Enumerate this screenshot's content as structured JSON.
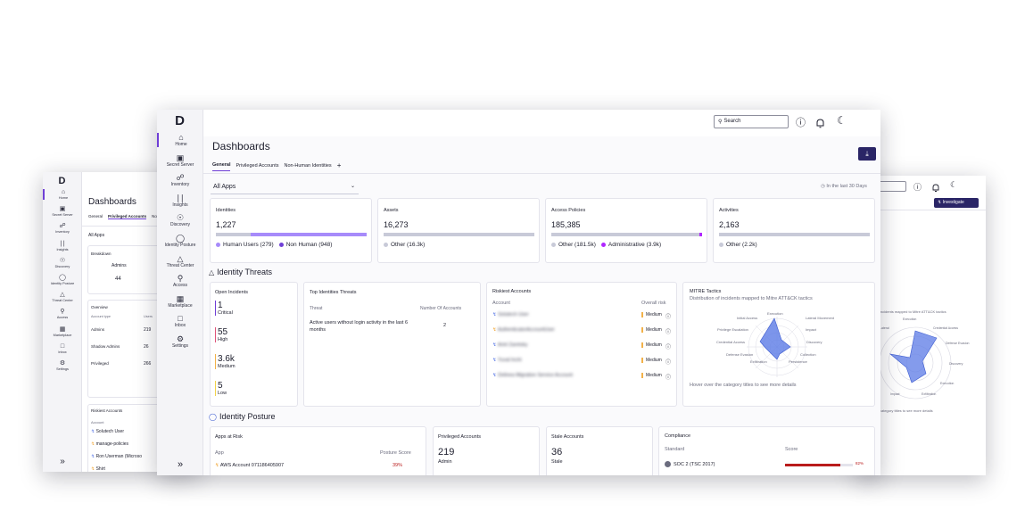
{
  "colors": {
    "accent": "#6f3fd6",
    "accent_light": "#a78bfa",
    "critical": "#b91c1c",
    "medium": "#f2b24a"
  },
  "nav": [
    {
      "label": "Home",
      "icon": "home-icon"
    },
    {
      "label": "Secret Server",
      "icon": "server-icon"
    },
    {
      "label": "Inventory",
      "icon": "inventory-icon"
    },
    {
      "label": "Insights",
      "icon": "chart-icon"
    },
    {
      "label": "Discovery",
      "icon": "compass-icon"
    },
    {
      "label": "Identity Posture",
      "icon": "shield-icon"
    },
    {
      "label": "Threat Center",
      "icon": "warning-icon"
    },
    {
      "label": "Access",
      "icon": "user-key-icon"
    },
    {
      "label": "Marketplace",
      "icon": "store-icon"
    },
    {
      "label": "Inbox",
      "icon": "inbox-icon"
    },
    {
      "label": "Settings",
      "icon": "gear-icon"
    }
  ],
  "back": {
    "title": "Dashboards",
    "tabs": [
      "General",
      "Privileged Accounts",
      "Non"
    ],
    "filter": "All Apps",
    "breakdown_label": "Breakdown",
    "breakdown_row": {
      "name": "Admins",
      "value": "44"
    },
    "overview": {
      "title": "Overview",
      "headers": [
        "Account type",
        "Users"
      ],
      "rows": [
        {
          "type": "Admins",
          "users": "219"
        },
        {
          "type": "Shadow Admins",
          "users": "26"
        },
        {
          "type": "Privileged",
          "users": "266"
        }
      ]
    },
    "riskiest": {
      "title": "Riskiest Accounts",
      "header": "Account",
      "rows": [
        "Solutech User",
        "manage-policies",
        "Ron Userman (Microso",
        "Shirt"
      ]
    },
    "collapse": "»"
  },
  "right": {
    "investigate": "Investigate",
    "caption": "incidents mapped to Mitre ATT&CK tactics",
    "labels": [
      "Execution",
      "Credential Access",
      "Defense Evasion",
      "Discovery",
      "Execution",
      "Exfiltration",
      "Impact",
      "Lateral"
    ],
    "hover": "category titles to see more details"
  },
  "front": {
    "title": "Dashboards",
    "search_placeholder": "Search",
    "tabs": [
      "General",
      "Privileged Accounts",
      "Non-Human Identities",
      "+"
    ],
    "filter": "All Apps",
    "period": "In the last 30 Days",
    "stats": [
      {
        "title": "Identities",
        "value": "1,227",
        "legend": [
          {
            "label": "Human Users (279)",
            "color": "#a78bfa"
          },
          {
            "label": "Non Human (948)",
            "color": "#6f3fd6"
          }
        ],
        "fill": 0.23
      },
      {
        "title": "Assets",
        "value": "16,273",
        "legend": [
          {
            "label": "Other (16.3k)",
            "color": "#c8cad8"
          }
        ]
      },
      {
        "title": "Access Policies",
        "value": "185,385",
        "legend": [
          {
            "label": "Other (181.5k)",
            "color": "#c8cad8"
          },
          {
            "label": "Administrative (3.9k)",
            "color": "#b026ff"
          }
        ]
      },
      {
        "title": "Activities",
        "value": "2,163",
        "legend": [
          {
            "label": "Other (2.2k)",
            "color": "#c8cad8"
          }
        ]
      }
    ],
    "threats_title": "Identity Threats",
    "open_incidents": {
      "title": "Open Incidents",
      "items": [
        {
          "value": "1",
          "label": "Critical",
          "color": "#6f3fd6"
        },
        {
          "value": "55",
          "label": "High",
          "color": "#e0557a"
        },
        {
          "value": "3.6k",
          "label": "Medium",
          "color": "#f2b24a"
        },
        {
          "value": "5",
          "label": "Low",
          "color": "#f2d24a"
        }
      ]
    },
    "top_threats": {
      "title": "Top Identities Threats",
      "headers": [
        "Threat",
        "Number Of Accounts"
      ],
      "rows": [
        {
          "threat": "Active users without login activity in the last 6 months",
          "count": "2"
        }
      ]
    },
    "riskiest": {
      "title": "Riskiest Accounts",
      "headers": [
        "Account",
        "Overall risk"
      ],
      "rows": [
        {
          "name": "Solutech User",
          "risk": "Medium"
        },
        {
          "name": "AuthenticatorAccountUser",
          "risk": "Medium"
        },
        {
          "name": "Ariel Zaretsky",
          "risk": "Medium"
        },
        {
          "name": "Yuval Inchi",
          "risk": "Medium"
        },
        {
          "name": "Delinea Migration Service Account",
          "risk": "Medium"
        }
      ]
    },
    "mitre": {
      "title": "MITRE Tactics",
      "subtitle": "Distribution of incidents mapped to Mitre ATT&CK tactics",
      "labels": [
        "Execution",
        "Initial Access",
        "Lateral Movement",
        "Privilege Escalation",
        "Impact",
        "Credential Access",
        "Discovery",
        "Defense Evasion",
        "Collection",
        "Exfiltration",
        "Persistence"
      ],
      "hover": "Hover over the category titles to see more details"
    },
    "posture_title": "Identity Posture",
    "apps_at_risk": {
      "title": "Apps at Risk",
      "headers": [
        "App",
        "Posture Score"
      ],
      "rows": [
        {
          "app": "AWS Account 071186405907",
          "score": "39%"
        }
      ]
    },
    "privileged": {
      "title": "Privileged Accounts",
      "value": "219",
      "label": "Admin"
    },
    "stale": {
      "title": "Stale Accounts",
      "value": "36",
      "label": "Stale"
    },
    "compliance": {
      "title": "Compliance",
      "headers": [
        "Standard",
        "Score"
      ],
      "rows": [
        {
          "standard": "SOC 2 (TSC 2017)",
          "score": "82%",
          "level": 0.82
        }
      ]
    },
    "collapse": "»"
  }
}
